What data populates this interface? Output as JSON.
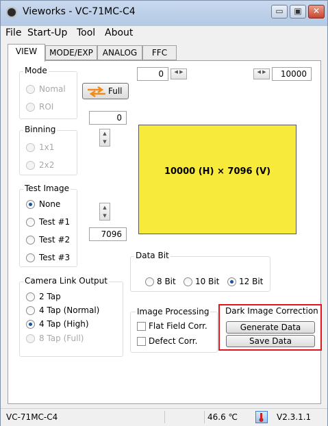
{
  "window": {
    "title": "Vieworks - VC-71MC-C4",
    "minimize": "▭",
    "maximize": "▣",
    "close": "✕"
  },
  "menu": [
    "File",
    "Start-Up",
    "Tool",
    "About"
  ],
  "tabs": [
    "VIEW",
    "MODE/EXP",
    "ANALOG",
    "FFC"
  ],
  "mode": {
    "label": "Mode",
    "options": [
      "Nomal",
      "ROI"
    ],
    "full_button": "Full"
  },
  "offset": {
    "x": "0",
    "width": "10000",
    "y": "0",
    "height": "7096"
  },
  "binning": {
    "label": "Binning",
    "options": [
      "1x1",
      "2x2"
    ]
  },
  "test_image": {
    "label": "Test Image",
    "options": [
      "None",
      "Test #1",
      "Test #2",
      "Test #3"
    ],
    "selected": "None"
  },
  "roi_preview": {
    "text": "10000 (H) × 7096 (V)",
    "color": "#f7ea3a"
  },
  "data_bit": {
    "label": "Data Bit",
    "options": [
      "8 Bit",
      "10 Bit",
      "12 Bit"
    ],
    "selected": "12 Bit"
  },
  "camera_link": {
    "label": "Camera Link Output",
    "options": [
      "2 Tap",
      "4 Tap (Normal)",
      "4 Tap (High)",
      "8 Tap (Full)"
    ],
    "selected": "4 Tap (High)"
  },
  "image_processing": {
    "label": "Image Processing",
    "options": [
      "Flat Field Corr.",
      "Defect Corr."
    ]
  },
  "dark_image": {
    "label": "Dark Image Correction",
    "generate": "Generate Data",
    "save": "Save Data",
    "highlight_color": "#e0141c"
  },
  "status": {
    "model": "VC-71MC-C4",
    "temperature": "46.6 ℃",
    "version": "V2.3.1.1"
  }
}
